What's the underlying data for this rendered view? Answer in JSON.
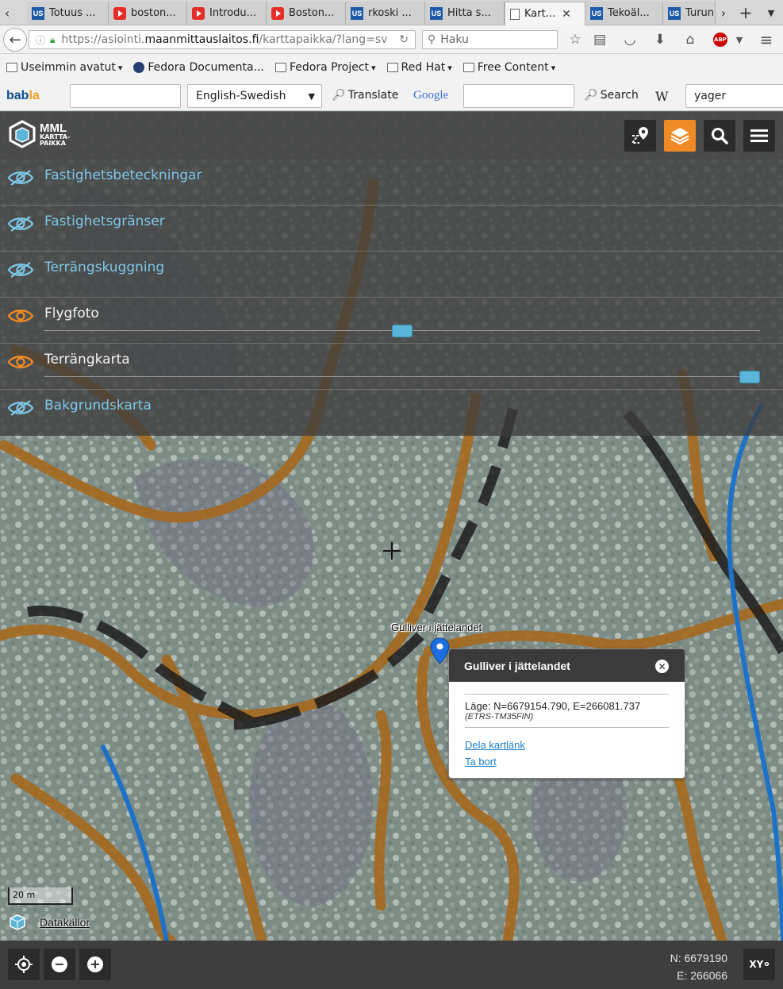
{
  "browser": {
    "tabs": [
      {
        "favicon": "us-icon",
        "label": "Totuus ..."
      },
      {
        "favicon": "youtube-icon",
        "label": "boston..."
      },
      {
        "favicon": "youtube-icon",
        "label": "Introdu..."
      },
      {
        "favicon": "youtube-icon",
        "label": "Boston..."
      },
      {
        "favicon": "us-icon",
        "label": "rkoski ..."
      },
      {
        "favicon": "us-icon",
        "label": "Hitta s..."
      },
      {
        "favicon": "page-icon",
        "label": "Kart..."
      },
      {
        "favicon": "us-icon",
        "label": "Tekoäl..."
      },
      {
        "favicon": "us-icon",
        "label": "Turun"
      }
    ],
    "url_prefix": "https://asiointi.",
    "url_domain": "maanmittauslaitos.fi",
    "url_path": "/karttapaikka/?lang=sv",
    "search_placeholder": "Haku",
    "bookmarks": [
      {
        "label": "Useimmin avatut",
        "icon": "folder-icon",
        "dropdown": true
      },
      {
        "label": "Fedora Documenta...",
        "icon": "fedora-icon",
        "dropdown": false
      },
      {
        "label": "Fedora Project",
        "icon": "folder-icon",
        "dropdown": true
      },
      {
        "label": "Red Hat",
        "icon": "folder-icon",
        "dropdown": true
      },
      {
        "label": "Free Content",
        "icon": "folder-icon",
        "dropdown": true
      }
    ],
    "toolbar2": {
      "babla_text": "bab",
      "babla_accent": "la",
      "language_select": "English-Swedish",
      "translate_label": "Translate",
      "google_label": "Google",
      "search_label": "Search",
      "wiki_label": "W",
      "wiki_value": "yager"
    }
  },
  "app": {
    "logo_line1": "MML",
    "logo_line2": "KARTTA-",
    "logo_line3": "PAIKKA",
    "layers": [
      {
        "name": "Fastighetsbeteckningar",
        "visible": false
      },
      {
        "name": "Fastighetsgränser",
        "visible": false
      },
      {
        "name": "Terrängskuggning",
        "visible": false
      },
      {
        "name": "Flygfoto",
        "visible": true,
        "opacity": 0.5
      },
      {
        "name": "Terrängkarta",
        "visible": true,
        "opacity": 1.0
      },
      {
        "name": "Bakgrundskarta",
        "visible": false
      }
    ],
    "marker_label": "Gulliver i jättelandet",
    "popup": {
      "title": "Gulliver i jättelandet",
      "coords": "Läge: N=6679154.790, E=266081.737",
      "crs": "(ETRS-TM35FIN)",
      "share_link": "Dela kartlänk",
      "remove_link": "Ta bort"
    },
    "scale_label": "20 m",
    "sources_label": "Datakällor",
    "coords_n": "N: 6679190",
    "coords_e": "E: 266066",
    "xy_label": "XY"
  },
  "colors": {
    "accent": "#f08a24",
    "layer_off": "#7ec8e8",
    "link": "#1a7ec8",
    "trail": "#a5691e",
    "road": "#1d1d1d",
    "stream": "#1d72c8"
  }
}
